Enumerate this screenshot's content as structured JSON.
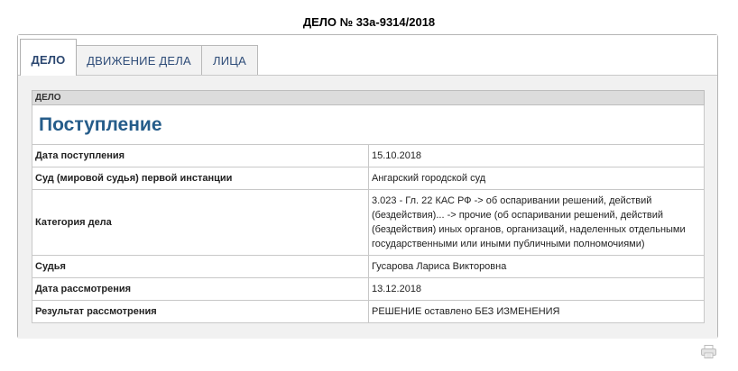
{
  "page": {
    "title": "ДЕЛО № 33а-9314/2018"
  },
  "tabs": [
    {
      "label": "ДЕЛО",
      "active": true
    },
    {
      "label": "ДВИЖЕНИЕ ДЕЛА",
      "active": false
    },
    {
      "label": "ЛИЦА",
      "active": false
    }
  ],
  "case": {
    "header": "ДЕЛО",
    "section": "Поступление",
    "rows": [
      {
        "label": "Дата поступления",
        "value": "15.10.2018"
      },
      {
        "label": "Суд (мировой судья) первой инстанции",
        "value": "Ангарский городской суд"
      },
      {
        "label": "Категория дела",
        "value": "3.023 - Гл. 22 КАС РФ -> об оспаривании решений, действий (бездействия)... -> прочие (об оспаривании решений, действий (бездействия) иных органов, организаций, наделенных отдельными государственными или иными публичными полномочиями)"
      },
      {
        "label": "Судья",
        "value": "Гусарова Лариса Викторовна"
      },
      {
        "label": "Дата рассмотрения",
        "value": "13.12.2018"
      },
      {
        "label": "Результат рассмотрения",
        "value": "РЕШЕНИЕ оставлено БЕЗ ИЗМЕНЕНИЯ"
      }
    ]
  },
  "icons": {
    "print": "printer-icon"
  },
  "colors": {
    "section_title": "#255c8a",
    "tab_text": "#2e4c78",
    "header_bg": "#dcdcdc",
    "content_bg": "#f1f1f1"
  }
}
